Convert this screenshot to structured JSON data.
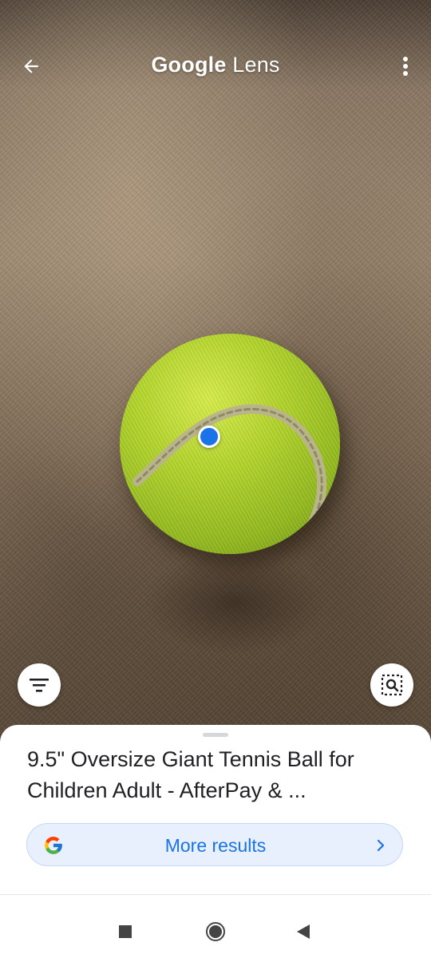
{
  "header": {
    "title_brand": "Google",
    "title_product": "Lens",
    "back_icon": "arrow-back-icon",
    "menu_icon": "more-vert-icon"
  },
  "camera": {
    "subject": "tennis-ball",
    "focus_color": "#1a73e8"
  },
  "controls": {
    "filter_icon": "filter-icon",
    "region_search_icon": "region-search-icon"
  },
  "result_sheet": {
    "title": "9.5\" Oversize Giant Tennis Ball for Children Adult - AfterPay & ...",
    "more_results_label": "More results",
    "more_results_icon": "google-g-icon",
    "accent_color": "#1a73e8"
  },
  "system_nav": {
    "recents_icon": "square-icon",
    "home_icon": "circle-icon",
    "back_icon": "triangle-back-icon"
  }
}
